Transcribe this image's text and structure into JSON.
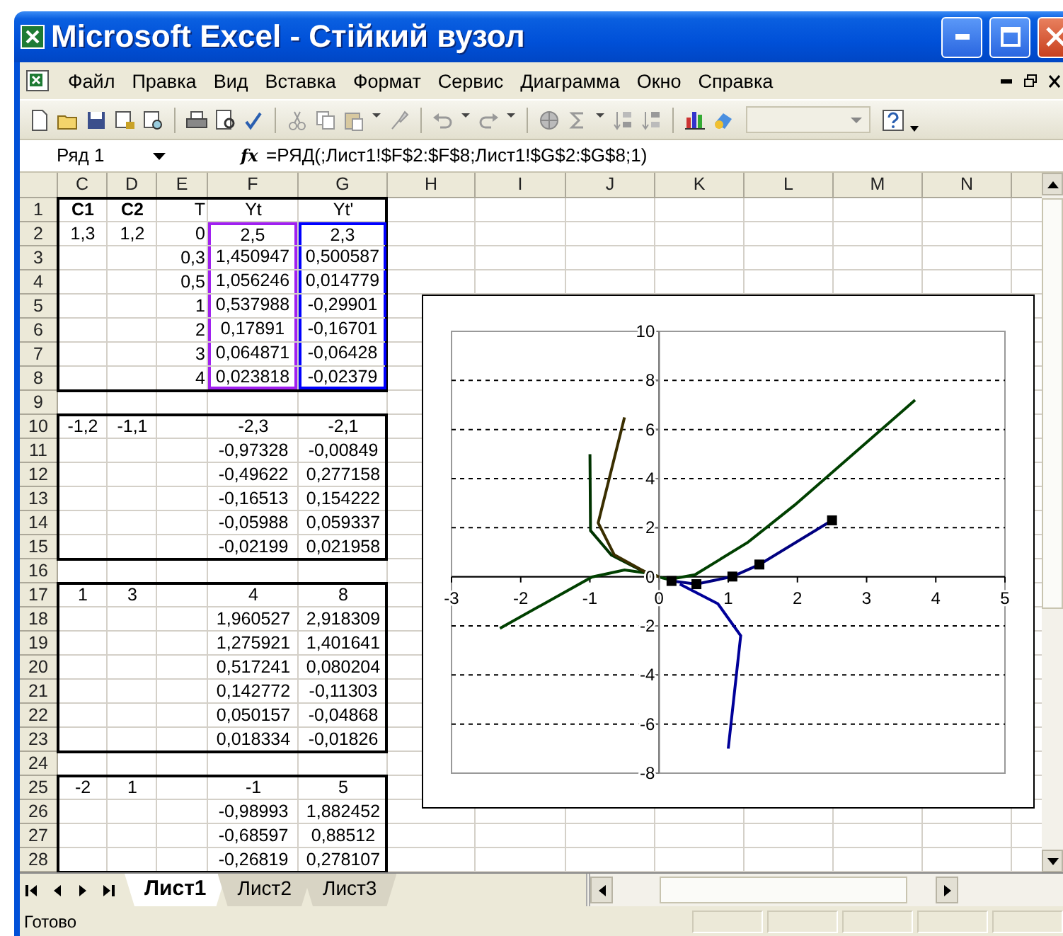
{
  "window": {
    "title": "Microsoft Excel - Стійкий вузол"
  },
  "menu": [
    "Файл",
    "Правка",
    "Вид",
    "Вставка",
    "Формат",
    "Сервис",
    "Диаграмма",
    "Окно",
    "Справка"
  ],
  "formula_bar": {
    "name_box": "Ряд 1",
    "function_button": "fx",
    "formula": "=РЯД(;Лист1!$F$2:$F$8;Лист1!$G$2:$G$8;1)"
  },
  "columns": [
    "C",
    "D",
    "E",
    "F",
    "G",
    "H",
    "I",
    "J",
    "K",
    "L",
    "M",
    "N"
  ],
  "row_groups": [
    {
      "boxed": true,
      "rows": [
        {
          "number": "1",
          "cells": [
            {
              "text": "C1",
              "bold": true
            },
            {
              "text": "C2",
              "bold": true
            },
            {
              "text": "T",
              "bold": false
            },
            {
              "text": "Yt",
              "bold": false
            },
            {
              "text": "Yt'",
              "bold": false
            }
          ]
        },
        {
          "number": "2",
          "cells": [
            {
              "text": "1,3",
              "bold": false
            },
            {
              "text": "1,2",
              "bold": false
            },
            {
              "text": "0",
              "bold": false
            },
            {
              "text": "2,5",
              "bold": false,
              "color": "#a020f0"
            },
            {
              "text": "2,3",
              "bold": false,
              "color": "#0000ff"
            }
          ]
        },
        {
          "number": "3",
          "cells": [
            null,
            null,
            {
              "text": "0,3",
              "bold": false
            },
            {
              "text": "1,450947",
              "bold": false,
              "color": "#a020f0"
            },
            {
              "text": "0,500587",
              "bold": false,
              "color": "#0000ff"
            }
          ]
        },
        {
          "number": "4",
          "cells": [
            null,
            null,
            {
              "text": "0,5",
              "bold": false
            },
            {
              "text": "1,056246",
              "bold": false,
              "color": "#a020f0"
            },
            {
              "text": "0,014779",
              "bold": false,
              "color": "#0000ff"
            }
          ]
        },
        {
          "number": "5",
          "cells": [
            null,
            null,
            {
              "text": "1",
              "bold": false
            },
            {
              "text": "0,537988",
              "bold": false,
              "color": "#a020f0"
            },
            {
              "text": "-0,29901",
              "bold": false,
              "color": "#0000ff"
            }
          ]
        },
        {
          "number": "6",
          "cells": [
            null,
            null,
            {
              "text": "2",
              "bold": false
            },
            {
              "text": "0,17891",
              "bold": false,
              "color": "#a020f0"
            },
            {
              "text": "-0,16701",
              "bold": false,
              "color": "#0000ff"
            }
          ]
        },
        {
          "number": "7",
          "cells": [
            null,
            null,
            {
              "text": "3",
              "bold": false
            },
            {
              "text": "0,064871",
              "bold": false,
              "color": "#a020f0"
            },
            {
              "text": "-0,06428",
              "bold": false,
              "color": "#0000ff"
            }
          ]
        },
        {
          "number": "8",
          "cells": [
            null,
            null,
            {
              "text": "4",
              "bold": false
            },
            {
              "text": "0,023818",
              "bold": false,
              "color": "#a020f0"
            },
            {
              "text": "-0,02379",
              "bold": false,
              "color": "#0000ff"
            }
          ]
        }
      ]
    },
    {
      "boxed": false,
      "rows": [
        {
          "number": "9"
        }
      ]
    },
    {
      "boxed": true,
      "rows": [
        {
          "number": "10",
          "cells": [
            {
              "text": "-1,2",
              "bold": false
            },
            {
              "text": "-1,1",
              "bold": false
            },
            null,
            {
              "text": "-2,3",
              "bold": false
            },
            {
              "text": "-2,1",
              "bold": false
            }
          ]
        },
        {
          "number": "11",
          "cells": [
            null,
            null,
            null,
            {
              "text": "-0,97328",
              "bold": false
            },
            {
              "text": "-0,00849",
              "bold": false
            }
          ]
        },
        {
          "number": "12",
          "cells": [
            null,
            null,
            null,
            {
              "text": "-0,49622",
              "bold": false
            },
            {
              "text": "0,277158",
              "bold": false
            }
          ]
        },
        {
          "number": "13",
          "cells": [
            null,
            null,
            null,
            {
              "text": "-0,16513",
              "bold": false
            },
            {
              "text": "0,154222",
              "bold": false
            }
          ]
        },
        {
          "number": "14",
          "cells": [
            null,
            null,
            null,
            {
              "text": "-0,05988",
              "bold": false
            },
            {
              "text": "0,059337",
              "bold": false
            }
          ]
        },
        {
          "number": "15",
          "cells": [
            null,
            null,
            null,
            {
              "text": "-0,02199",
              "bold": false
            },
            {
              "text": "0,021958",
              "bold": false
            }
          ]
        }
      ]
    },
    {
      "boxed": false,
      "rows": [
        {
          "number": "16"
        }
      ]
    },
    {
      "boxed": true,
      "rows": [
        {
          "number": "17",
          "cells": [
            {
              "text": "1",
              "bold": false
            },
            {
              "text": "3",
              "bold": false
            },
            null,
            {
              "text": "4",
              "bold": false
            },
            {
              "text": "8",
              "bold": false
            }
          ]
        },
        {
          "number": "18",
          "cells": [
            null,
            null,
            null,
            {
              "text": "1,960527",
              "bold": false
            },
            {
              "text": "2,918309",
              "bold": false
            }
          ]
        },
        {
          "number": "19",
          "cells": [
            null,
            null,
            null,
            {
              "text": "1,275921",
              "bold": false
            },
            {
              "text": "1,401641",
              "bold": false
            }
          ]
        },
        {
          "number": "20",
          "cells": [
            null,
            null,
            null,
            {
              "text": "0,517241",
              "bold": false
            },
            {
              "text": "0,080204",
              "bold": false
            }
          ]
        },
        {
          "number": "21",
          "cells": [
            null,
            null,
            null,
            {
              "text": "0,142772",
              "bold": false
            },
            {
              "text": "-0,11303",
              "bold": false
            }
          ]
        },
        {
          "number": "22",
          "cells": [
            null,
            null,
            null,
            {
              "text": "0,050157",
              "bold": false
            },
            {
              "text": "-0,04868",
              "bold": false
            }
          ]
        },
        {
          "number": "23",
          "cells": [
            null,
            null,
            null,
            {
              "text": "0,018334",
              "bold": false
            },
            {
              "text": "-0,01826",
              "bold": false
            }
          ]
        }
      ]
    },
    {
      "boxed": false,
      "rows": [
        {
          "number": "24"
        }
      ]
    },
    {
      "boxed": true,
      "rows": [
        {
          "number": "25",
          "cells": [
            {
              "text": "-2",
              "bold": false
            },
            {
              "text": "1",
              "bold": false
            },
            null,
            {
              "text": "-1",
              "bold": false
            },
            {
              "text": "5",
              "bold": false
            }
          ]
        },
        {
          "number": "26",
          "cells": [
            null,
            null,
            null,
            {
              "text": "-0,98993",
              "bold": false
            },
            {
              "text": "1,882452",
              "bold": false
            }
          ]
        },
        {
          "number": "27",
          "cells": [
            null,
            null,
            null,
            {
              "text": "-0,68597",
              "bold": false
            },
            {
              "text": "0,88512",
              "bold": false
            }
          ]
        },
        {
          "number": "28",
          "cells": [
            null,
            null,
            null,
            {
              "text": "-0,26819",
              "bold": false
            },
            {
              "text": "0,278107",
              "bold": false
            }
          ]
        }
      ]
    }
  ],
  "chart": {
    "chart_data": {
      "type": "line",
      "grid": true,
      "xlim": [
        -3,
        5
      ],
      "ylim": [
        -8,
        10
      ],
      "xticks": [
        {
          "value": -3,
          "label": "-3"
        },
        {
          "value": -2,
          "label": "-2"
        },
        {
          "value": -1,
          "label": "-1"
        },
        {
          "value": 0,
          "label": "0"
        },
        {
          "value": 1,
          "label": "1"
        },
        {
          "value": 2,
          "label": "2"
        },
        {
          "value": 3,
          "label": "3"
        },
        {
          "value": 4,
          "label": "4"
        },
        {
          "value": 5,
          "label": "5"
        }
      ],
      "yticks": [
        {
          "value": -8,
          "label": "-8"
        },
        {
          "value": -6,
          "label": "-6"
        },
        {
          "value": -4,
          "label": "-4"
        },
        {
          "value": -2,
          "label": "-2"
        },
        {
          "value": 0,
          "label": "0"
        },
        {
          "value": 2,
          "label": "2"
        },
        {
          "value": 4,
          "label": "4"
        },
        {
          "value": 6,
          "label": "6"
        },
        {
          "value": 8,
          "label": "8"
        },
        {
          "value": 10,
          "label": "10"
        }
      ],
      "series": [
        {
          "color": "#000080",
          "marker": "square",
          "x": [
            2.5,
            1.45,
            1.06,
            0.54,
            0.18
          ],
          "values": [
            2.3,
            0.5,
            0.01,
            -0.3,
            -0.17
          ]
        },
        {
          "color": "#004000",
          "x": [
            -2.3,
            -0.97,
            -0.5,
            -0.17,
            -0.06,
            -0.02
          ],
          "values": [
            -2.1,
            -0.01,
            0.28,
            0.15,
            0.06,
            0.02
          ]
        },
        {
          "color": "#004000",
          "x": [
            3.7,
            1.96,
            1.28,
            0.52,
            0.14,
            0.05,
            0.02
          ],
          "values": [
            7.2,
            2.92,
            1.4,
            0.08,
            -0.11,
            -0.05,
            -0.02
          ]
        },
        {
          "color": "#003300",
          "x": [
            -1,
            -0.99,
            -0.69,
            -0.27,
            -0.05
          ],
          "values": [
            5,
            1.88,
            0.89,
            0.28,
            0.05
          ]
        },
        {
          "color": "#3a2e00",
          "x": [
            -0.5,
            -0.88,
            -0.65,
            -0.2,
            0
          ],
          "values": [
            6.5,
            2.2,
            0.9,
            0.2,
            0
          ]
        },
        {
          "color": "#000099",
          "x": [
            1,
            1.18,
            0.85,
            0.3
          ],
          "values": [
            -7,
            -2.4,
            -1.1,
            -0.3
          ]
        }
      ]
    }
  },
  "sheet_tabs": [
    {
      "label": "Лист1",
      "selected": true
    },
    {
      "label": "Лист2",
      "selected": false
    },
    {
      "label": "Лист3",
      "selected": false
    }
  ],
  "status_bar": "Готово"
}
